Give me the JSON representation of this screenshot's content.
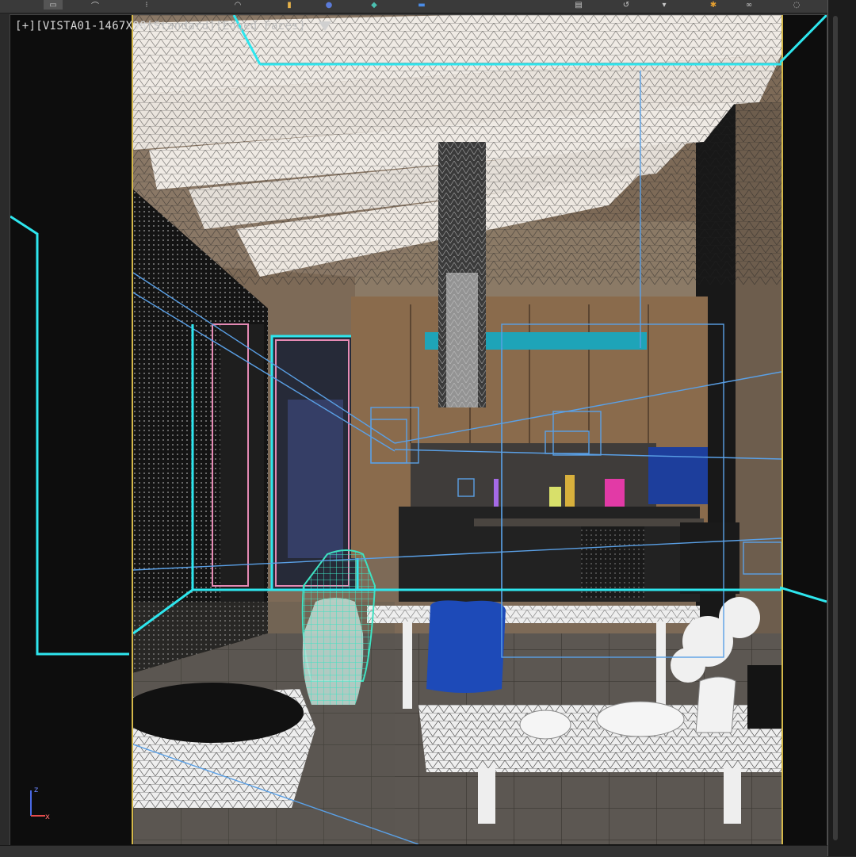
{
  "toolbar": {
    "icons": [
      "snap-icon",
      "angle-snap-icon",
      "percent-snap-icon",
      "spinner-snap-icon",
      "render-setup-icon",
      "material-editor-icon",
      "render-frame-icon",
      "render-icon",
      "scripts-icon",
      "viewport-layout-icon",
      "teapot-icon",
      "settings-icon",
      "close-icon"
    ]
  },
  "viewport": {
    "label_plus": "[+]",
    "label_camera": "[VISTA01-1467X98",
    "label_shading": "[Standard]",
    "label_mode": "[Edged Faces]",
    "filter_icon": "filter-icon"
  },
  "gizmo": {
    "z": "z",
    "x": "x"
  },
  "colors": {
    "safe_frame": "#d4b84a",
    "camera_line": "#2ee6ee",
    "wire_blue": "#5aa0e6",
    "vase_teal": "#3ee2c2",
    "ceiling_white": "#efeae4",
    "floor_gray": "#5a5550",
    "cabinet_wood": "#8a6b4c",
    "accent_teal": "#1ea4b8",
    "fabric_blue": "#1d4ab8"
  }
}
